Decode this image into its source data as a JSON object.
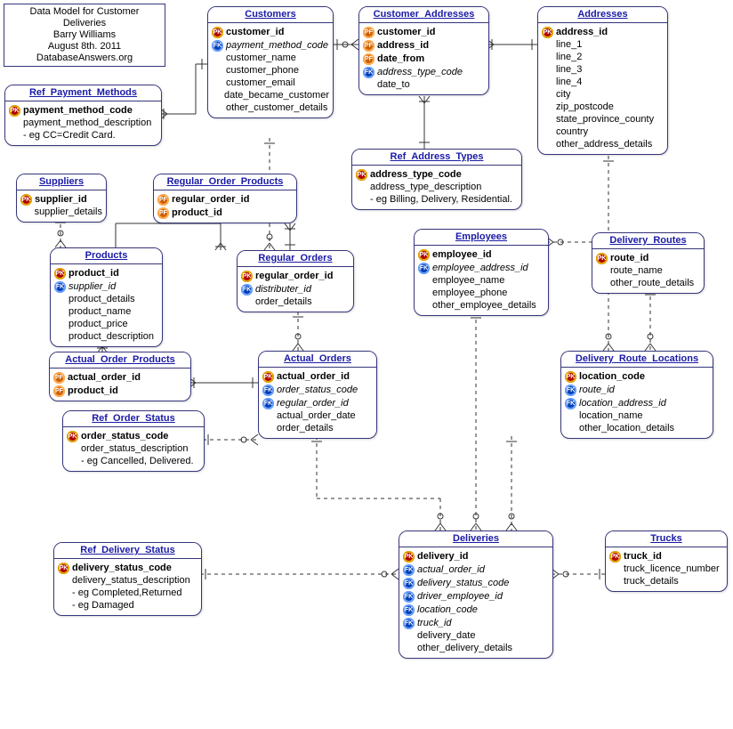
{
  "meta": {
    "title_line1": "Data Model for Customer Deliveries",
    "title_line2": "Barry Williams",
    "title_line3": "August 8th. 2011",
    "title_line4": "DatabaseAnswers.org"
  },
  "entities": {
    "customers": {
      "title": "Customers",
      "rows": [
        {
          "icon": "pk",
          "label": "customer_id",
          "bold": true
        },
        {
          "icon": "fk",
          "label": "payment_method_code",
          "italic": true
        },
        {
          "icon": "",
          "label": "customer_name"
        },
        {
          "icon": "",
          "label": "customer_phone"
        },
        {
          "icon": "",
          "label": "customer_email"
        },
        {
          "icon": "",
          "label": "date_became_customer"
        },
        {
          "icon": "",
          "label": "other_customer_details"
        }
      ]
    },
    "customer_addresses": {
      "title": "Customer_Addresses",
      "rows": [
        {
          "icon": "pf",
          "label": "customer_id",
          "bold": true
        },
        {
          "icon": "pf",
          "label": "address_id",
          "bold": true
        },
        {
          "icon": "pf",
          "label": "date_from",
          "bold": true
        },
        {
          "icon": "fk",
          "label": "address_type_code",
          "italic": true
        },
        {
          "icon": "",
          "label": "date_to"
        }
      ]
    },
    "addresses": {
      "title": "Addresses",
      "rows": [
        {
          "icon": "pk",
          "label": "address_id",
          "bold": true
        },
        {
          "icon": "",
          "label": "line_1"
        },
        {
          "icon": "",
          "label": "line_2"
        },
        {
          "icon": "",
          "label": "line_3"
        },
        {
          "icon": "",
          "label": "line_4"
        },
        {
          "icon": "",
          "label": "city"
        },
        {
          "icon": "",
          "label": "zip_postcode"
        },
        {
          "icon": "",
          "label": "state_province_county"
        },
        {
          "icon": "",
          "label": "country"
        },
        {
          "icon": "",
          "label": "other_address_details"
        }
      ]
    },
    "ref_payment_methods": {
      "title": "Ref_Payment_Methods",
      "rows": [
        {
          "icon": "pk",
          "label": "payment_method_code",
          "bold": true
        },
        {
          "icon": "",
          "label": "payment_method_description"
        },
        {
          "icon": "",
          "label": "- eg CC=Credit Card."
        }
      ]
    },
    "ref_address_types": {
      "title": "Ref_Address_Types",
      "rows": [
        {
          "icon": "pk",
          "label": "address_type_code",
          "bold": true
        },
        {
          "icon": "",
          "label": "address_type_description"
        },
        {
          "icon": "",
          "label": "- eg Billing, Delivery, Residential."
        }
      ]
    },
    "suppliers": {
      "title": "Suppliers",
      "rows": [
        {
          "icon": "pk",
          "label": "supplier_id",
          "bold": true
        },
        {
          "icon": "",
          "label": "supplier_details"
        }
      ]
    },
    "regular_order_products": {
      "title": "Regular_Order_Products",
      "rows": [
        {
          "icon": "pf",
          "label": "regular_order_id",
          "bold": true
        },
        {
          "icon": "pf",
          "label": "product_id",
          "bold": true
        }
      ]
    },
    "products": {
      "title": "Products",
      "rows": [
        {
          "icon": "pk",
          "label": "product_id",
          "bold": true
        },
        {
          "icon": "fk",
          "label": "supplier_id",
          "italic": true
        },
        {
          "icon": "",
          "label": "product_details"
        },
        {
          "icon": "",
          "label": "product_name"
        },
        {
          "icon": "",
          "label": "product_price"
        },
        {
          "icon": "",
          "label": "product_description"
        }
      ]
    },
    "regular_orders": {
      "title": "Regular_Orders",
      "rows": [
        {
          "icon": "pk",
          "label": "regular_order_id",
          "bold": true
        },
        {
          "icon": "fk",
          "label": "distributer_id",
          "italic": true
        },
        {
          "icon": "",
          "label": "order_details"
        }
      ]
    },
    "employees": {
      "title": "Employees",
      "rows": [
        {
          "icon": "pk",
          "label": "employee_id",
          "bold": true
        },
        {
          "icon": "fk",
          "label": "employee_address_id",
          "italic": true
        },
        {
          "icon": "",
          "label": "employee_name"
        },
        {
          "icon": "",
          "label": "employee_phone"
        },
        {
          "icon": "",
          "label": "other_employee_details"
        }
      ]
    },
    "delivery_routes": {
      "title": "Delivery_Routes",
      "rows": [
        {
          "icon": "pk",
          "label": "route_id",
          "bold": true
        },
        {
          "icon": "",
          "label": "route_name"
        },
        {
          "icon": "",
          "label": "other_route_details"
        }
      ]
    },
    "actual_order_products": {
      "title": "Actual_Order_Products",
      "rows": [
        {
          "icon": "pf",
          "label": "actual_order_id",
          "bold": true
        },
        {
          "icon": "pf",
          "label": "product_id",
          "bold": true
        }
      ]
    },
    "actual_orders": {
      "title": "Actual_Orders",
      "rows": [
        {
          "icon": "pk",
          "label": "actual_order_id",
          "bold": true
        },
        {
          "icon": "fk",
          "label": "order_status_code",
          "italic": true
        },
        {
          "icon": "fk",
          "label": "regular_order_id",
          "italic": true
        },
        {
          "icon": "",
          "label": "actual_order_date"
        },
        {
          "icon": "",
          "label": "order_details"
        }
      ]
    },
    "delivery_route_locations": {
      "title": "Delivery_Route_Locations",
      "rows": [
        {
          "icon": "pk",
          "label": "location_code",
          "bold": true
        },
        {
          "icon": "fk",
          "label": "route_id",
          "italic": true
        },
        {
          "icon": "fk",
          "label": "location_address_id",
          "italic": true
        },
        {
          "icon": "",
          "label": "location_name"
        },
        {
          "icon": "",
          "label": "other_location_details"
        }
      ]
    },
    "ref_order_status": {
      "title": "Ref_Order_Status",
      "rows": [
        {
          "icon": "pk",
          "label": "order_status_code",
          "bold": true
        },
        {
          "icon": "",
          "label": "order_status_description"
        },
        {
          "icon": "",
          "label": "- eg Cancelled, Delivered."
        }
      ]
    },
    "ref_delivery_status": {
      "title": "Ref_Delivery_Status",
      "rows": [
        {
          "icon": "pk",
          "label": "delivery_status_code",
          "bold": true
        },
        {
          "icon": "",
          "label": "delivery_status_description"
        },
        {
          "icon": "",
          "label": "- eg Completed,Returned"
        },
        {
          "icon": "",
          "label": "- eg Damaged"
        }
      ]
    },
    "deliveries": {
      "title": "Deliveries",
      "rows": [
        {
          "icon": "pk",
          "label": "delivery_id",
          "bold": true
        },
        {
          "icon": "fk",
          "label": "actual_order_id",
          "italic": true
        },
        {
          "icon": "fk",
          "label": "delivery_status_code",
          "italic": true
        },
        {
          "icon": "fk",
          "label": "driver_employee_id",
          "italic": true
        },
        {
          "icon": "fk",
          "label": "location_code",
          "italic": true
        },
        {
          "icon": "fk",
          "label": "truck_id",
          "italic": true
        },
        {
          "icon": "",
          "label": "delivery_date"
        },
        {
          "icon": "",
          "label": "other_delivery_details"
        }
      ]
    },
    "trucks": {
      "title": "Trucks",
      "rows": [
        {
          "icon": "pk",
          "label": "truck_id",
          "bold": true
        },
        {
          "icon": "",
          "label": "truck_licence_number"
        },
        {
          "icon": "",
          "label": "truck_details"
        }
      ]
    }
  }
}
